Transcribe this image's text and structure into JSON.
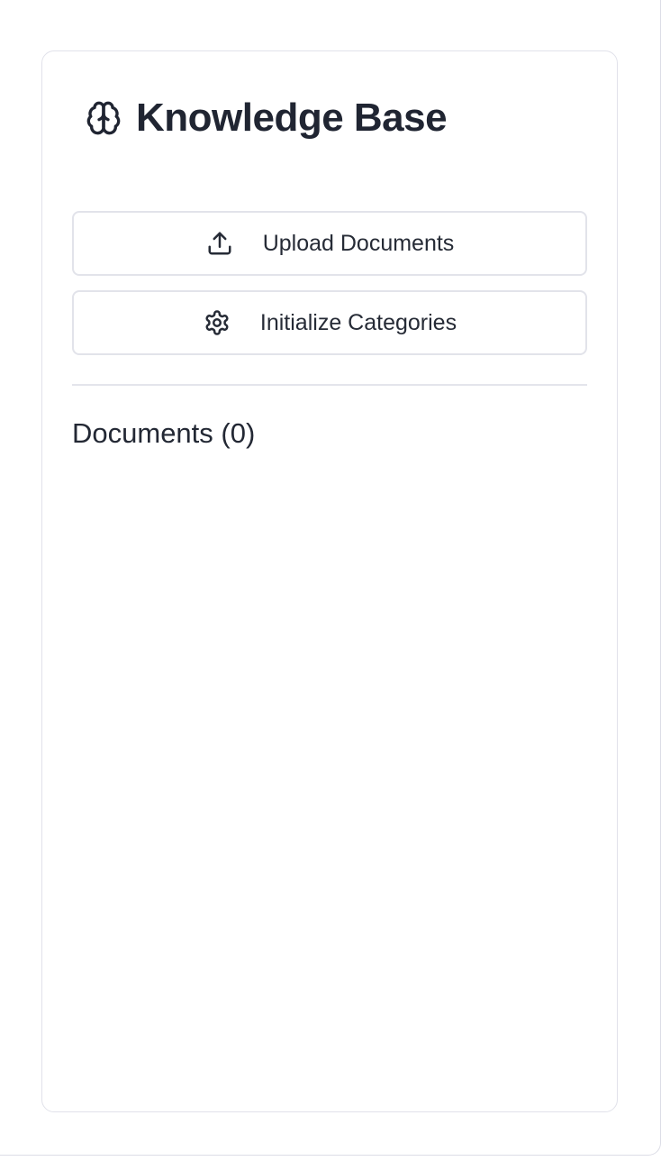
{
  "panel": {
    "title": "Knowledge Base",
    "title_icon": "brain-icon"
  },
  "actions": {
    "upload": {
      "label": "Upload Documents",
      "icon": "upload-icon"
    },
    "initialize": {
      "label": "Initialize Categories",
      "icon": "gear-icon"
    }
  },
  "documents": {
    "heading": "Documents (0)",
    "items": []
  },
  "colors": {
    "text": "#202532",
    "border": "#e1e2ea",
    "background": "#ffffff"
  }
}
